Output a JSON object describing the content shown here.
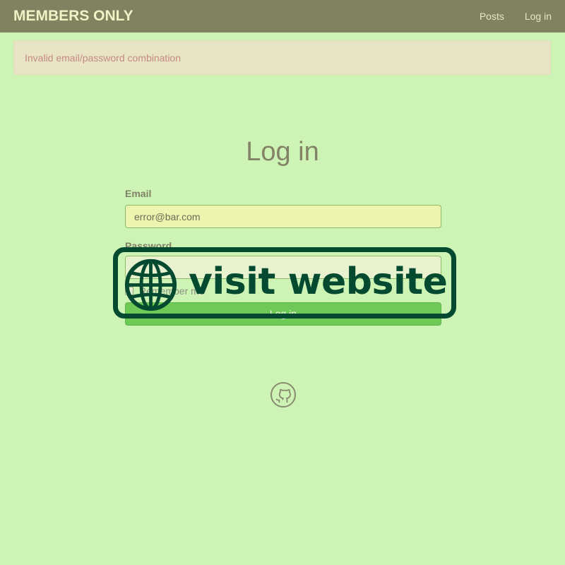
{
  "navbar": {
    "brand": "MEMBERS ONLY",
    "links": [
      "Posts",
      "Log in"
    ]
  },
  "alert": {
    "message": "Invalid email/password combination"
  },
  "page": {
    "title": "Log in"
  },
  "form": {
    "email_label": "Email",
    "email_value": "error@bar.com",
    "password_label": "Password",
    "password_value": "",
    "remember_label": "Remember me",
    "submit_label": "Log in"
  },
  "footer": {
    "icon": "github-icon"
  },
  "overlay": {
    "text": "visit website",
    "icon": "globe-icon"
  },
  "colors": {
    "background": "#cdf3b5",
    "navbar": "#828261",
    "alert_bg": "#eae4c7",
    "alert_text": "#c3897d",
    "button": "#6ec956",
    "overlay": "#034a31"
  }
}
